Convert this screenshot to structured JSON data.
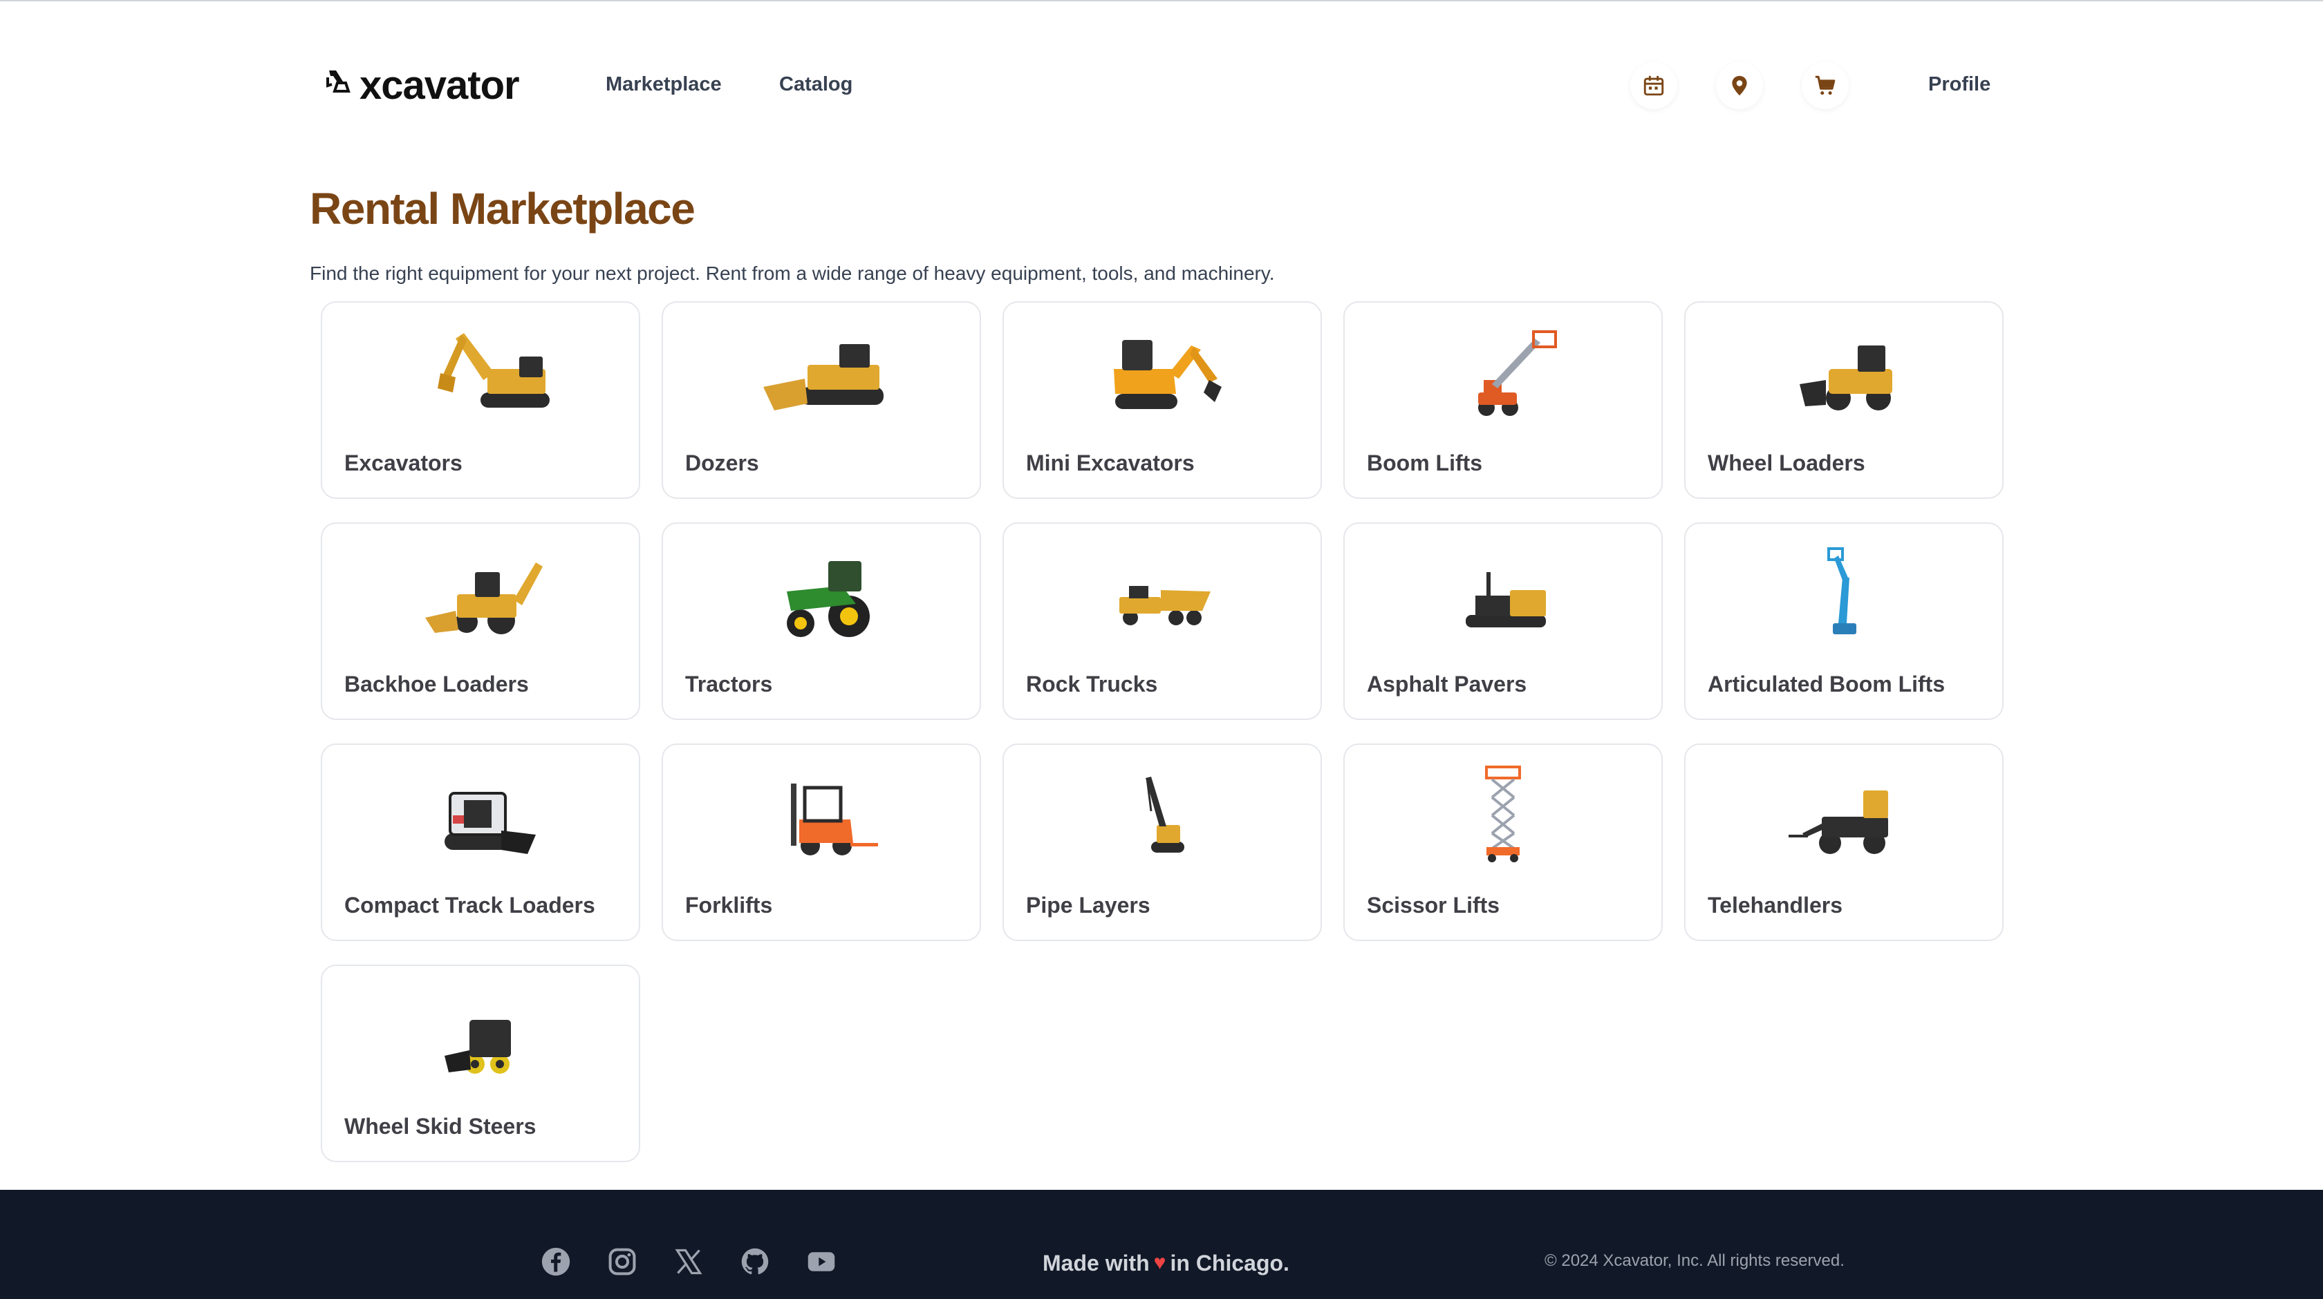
{
  "header": {
    "logo_text": "xcavator",
    "nav": {
      "marketplace": "Marketplace",
      "catalog": "Catalog",
      "profile": "Profile"
    },
    "icons": [
      "calendar-icon",
      "location-pin-icon",
      "cart-icon"
    ],
    "icon_color": "#7a4515"
  },
  "main": {
    "title": "Rental Marketplace",
    "description": "Find the right equipment for your next project. Rent from a wide range of heavy equipment, tools, and machinery.",
    "categories": [
      {
        "label": "Excavators",
        "icon": "excavator-image"
      },
      {
        "label": "Dozers",
        "icon": "dozer-image"
      },
      {
        "label": "Mini Excavators",
        "icon": "mini-excavator-image"
      },
      {
        "label": "Boom Lifts",
        "icon": "boom-lift-image"
      },
      {
        "label": "Wheel Loaders",
        "icon": "wheel-loader-image"
      },
      {
        "label": "Backhoe Loaders",
        "icon": "backhoe-loader-image"
      },
      {
        "label": "Tractors",
        "icon": "tractor-image"
      },
      {
        "label": "Rock Trucks",
        "icon": "rock-truck-image"
      },
      {
        "label": "Asphalt Pavers",
        "icon": "asphalt-paver-image"
      },
      {
        "label": "Articulated Boom Lifts",
        "icon": "articulated-boom-lift-image"
      },
      {
        "label": "Compact Track Loaders",
        "icon": "compact-track-loader-image"
      },
      {
        "label": "Forklifts",
        "icon": "forklift-image"
      },
      {
        "label": "Pipe Layers",
        "icon": "pipe-layer-image"
      },
      {
        "label": "Scissor Lifts",
        "icon": "scissor-lift-image"
      },
      {
        "label": "Telehandlers",
        "icon": "telehandler-image"
      },
      {
        "label": "Wheel Skid Steers",
        "icon": "wheel-skid-steer-image"
      }
    ]
  },
  "footer": {
    "social": [
      "facebook-icon",
      "instagram-icon",
      "x-icon",
      "github-icon",
      "youtube-icon"
    ],
    "made_prefix": "Made with",
    "made_suffix": "in Chicago.",
    "copyright": "© 2024 Xcavator, Inc. All rights reserved."
  }
}
